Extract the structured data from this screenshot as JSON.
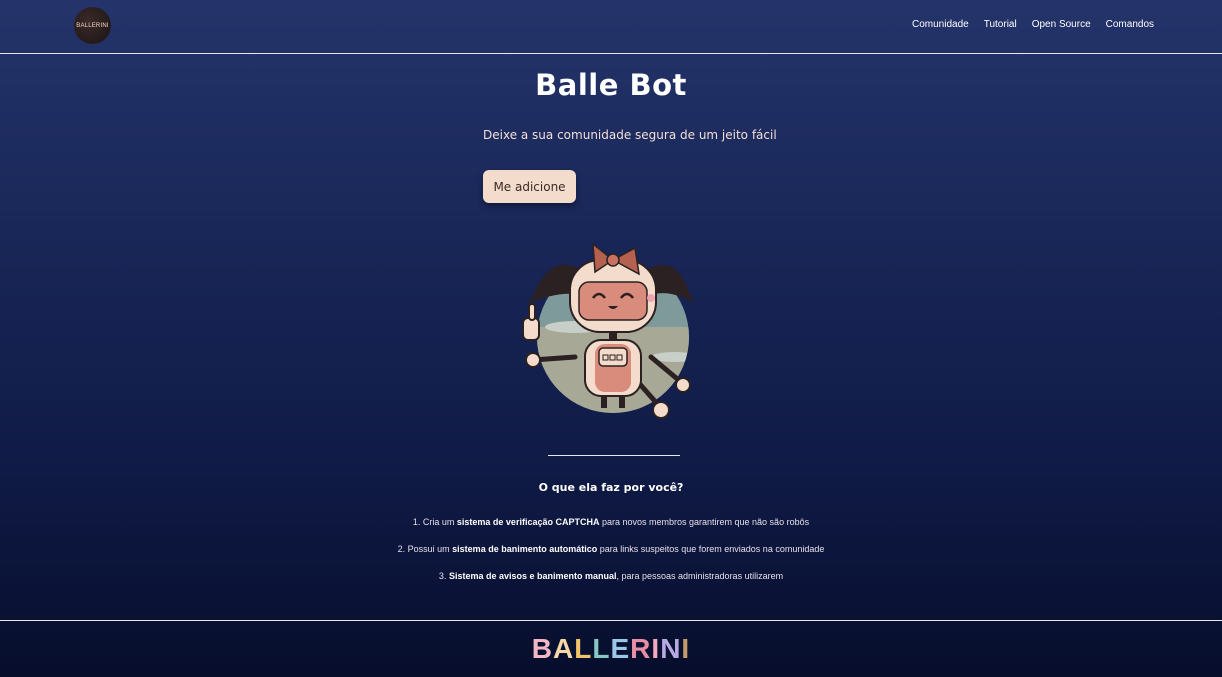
{
  "nav": {
    "logo_text": "BALLERINI",
    "links": [
      "Comunidade",
      "Tutorial",
      "Open Source",
      "Comandos"
    ]
  },
  "hero": {
    "title": "Balle Bot",
    "subtitle": "Deixe a sua comunidade segura de um jeito fácil",
    "cta_label": "Me adicione"
  },
  "features": {
    "title": "O que ela faz por você?",
    "items": [
      {
        "prefix": "1. Cria um ",
        "bold": "sistema de verificação CAPTCHA",
        "suffix": " para novos membros garantirem que não são robôs"
      },
      {
        "prefix": "2. Possui um ",
        "bold": "sistema de banimento automático",
        "suffix": " para links suspeitos que forem enviados na comunidade"
      },
      {
        "prefix": "3. ",
        "bold": "Sistema de avisos e banimento manual",
        "suffix": ", para pessoas administradoras utilizarem"
      }
    ]
  },
  "footer": {
    "brand_letters": [
      "B",
      "A",
      "L",
      "L",
      "E",
      "R",
      "I",
      "N",
      "I"
    ],
    "brand_colors": [
      "#f3b8c8",
      "#f6d8a8",
      "#f2c46a",
      "#86c9c2",
      "#9bc8e8",
      "#e88fa5",
      "#f4a9c0",
      "#b8a9e0",
      "#c79a6e"
    ]
  },
  "colors": {
    "cta_bg": "#f3dccb",
    "robot_pink": "#d98b7c",
    "robot_cream": "#f3dccb",
    "robot_dark": "#2b2022"
  }
}
